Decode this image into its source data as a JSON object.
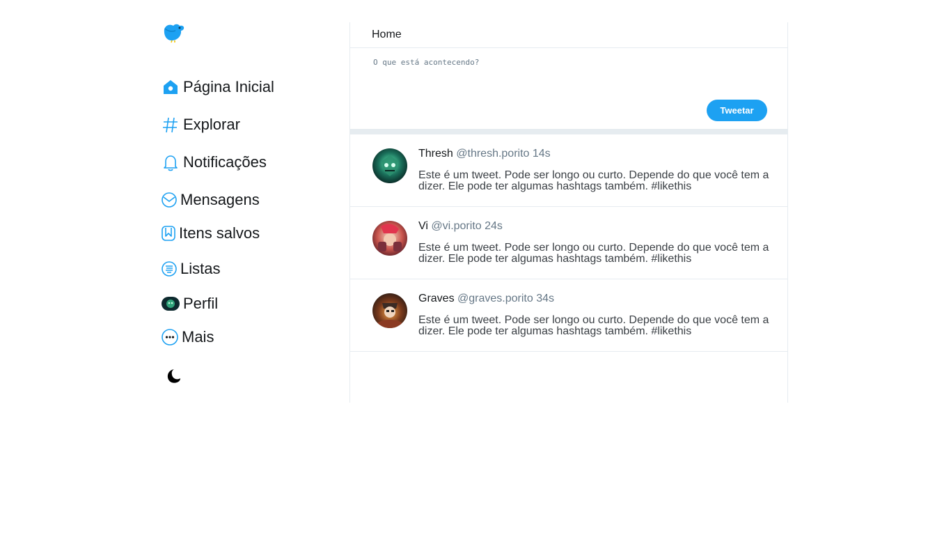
{
  "colors": {
    "accent": "#1da1f2",
    "border": "#e6ecf0",
    "muted_text": "#657786"
  },
  "sidebar": {
    "logo_icon": "bird-icon",
    "items": [
      {
        "label": "Página Inicial",
        "icon": "home-icon"
      },
      {
        "label": "Explorar",
        "icon": "hashtag-icon"
      },
      {
        "label": "Notificações",
        "icon": "bell-icon"
      },
      {
        "label": "Mensagens",
        "icon": "envelope-icon"
      },
      {
        "label": "Itens salvos",
        "icon": "bookmark-icon"
      },
      {
        "label": "Listas",
        "icon": "list-icon"
      },
      {
        "label": "Perfil",
        "icon": "profile-avatar-icon"
      },
      {
        "label": "Mais",
        "icon": "more-icon"
      }
    ],
    "theme_toggle_icon": "moon-icon"
  },
  "main": {
    "title": "Home",
    "composer": {
      "placeholder": "O que está acontecendo?",
      "button_label": "Tweetar"
    },
    "tweets": [
      {
        "name": "Thresh",
        "meta": "@thresh.porito 14s",
        "text": "Este é um tweet. Pode ser longo ou curto. Depende do que você tem a dizer. Ele pode ter algumas hashtags também. #likethis"
      },
      {
        "name": "Vi",
        "meta": "@vi.porito 24s",
        "text": "Este é um tweet. Pode ser longo ou curto. Depende do que você tem a dizer. Ele pode ter algumas hashtags também. #likethis"
      },
      {
        "name": "Graves",
        "meta": "@graves.porito 34s",
        "text": "Este é um tweet. Pode ser longo ou curto. Depende do que você tem a dizer. Ele pode ter algumas hashtags também. #likethis"
      }
    ]
  }
}
